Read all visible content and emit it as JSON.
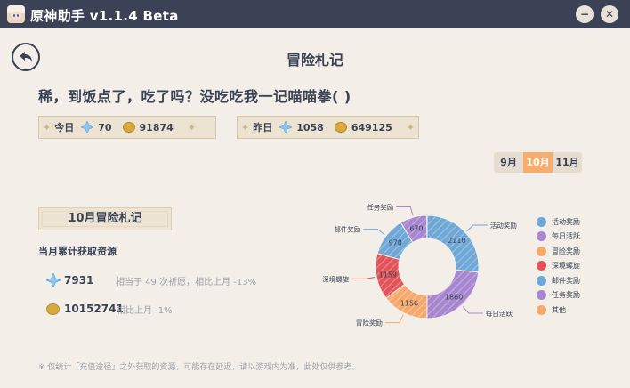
{
  "window": {
    "title": "原神助手 v1.1.4 Beta",
    "minimize_label": "−",
    "close_label": "✕"
  },
  "page": {
    "title": "冒险札记",
    "greeting": "稀，到饭点了，吃了吗？没吃吃我一记喵喵拳( )"
  },
  "today": {
    "label": "今日",
    "primogems": "70",
    "mora": "91874"
  },
  "yesterday": {
    "label": "昨日",
    "primogems": "1058",
    "mora": "649125"
  },
  "month_tabs": [
    {
      "label": "9月",
      "active": false
    },
    {
      "label": "10月",
      "active": true
    },
    {
      "label": "11月",
      "active": false
    }
  ],
  "monthly": {
    "title": "10月冒险札记",
    "subtitle": "当月累计获取资源",
    "primogems": {
      "value": "7931",
      "note": "相当于 49 次祈愿，相比上月 -13%"
    },
    "mora": {
      "value": "10152741",
      "note": "相比上月 -1%"
    }
  },
  "footnote": "※ 仅统计「充值途径」之外获取的资源，可能存在延迟，请以游戏内为准，此处仅供参考。",
  "chart_data": {
    "type": "pie",
    "style": "donut",
    "values": [
      2110,
      1860,
      1156,
      1159,
      970,
      670,
      6
    ],
    "categories": [
      "活动奖励",
      "每日活跃",
      "冒险奖励",
      "深境螺旋",
      "邮件奖励",
      "任务奖励",
      "其他"
    ],
    "data_labels": [
      "2110",
      "1860",
      "1156",
      "1159",
      "970",
      "670",
      ""
    ],
    "colors": [
      "#6fa8d6",
      "#a787cf",
      "#f6a96c",
      "#e0545a",
      "#6fa8d6",
      "#a787cf",
      "#f6a96c"
    ],
    "legend": "right"
  }
}
